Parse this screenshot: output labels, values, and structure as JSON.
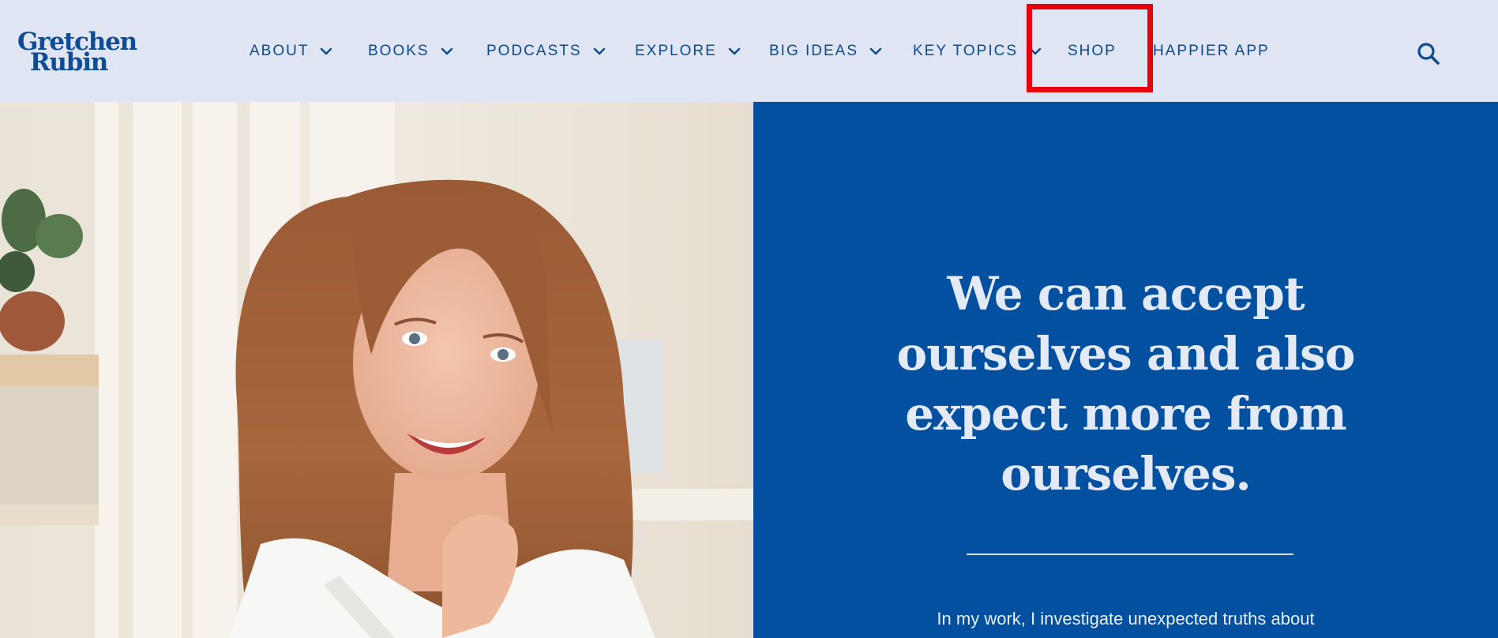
{
  "logo": {
    "line1": "Gretchen",
    "line2": "Rubin"
  },
  "nav": {
    "items": [
      {
        "label": "ABOUT",
        "has_dropdown": true
      },
      {
        "label": "BOOKS",
        "has_dropdown": true
      },
      {
        "label": "PODCASTS",
        "has_dropdown": true
      },
      {
        "label": "EXPLORE",
        "has_dropdown": true
      },
      {
        "label": "BIG IDEAS",
        "has_dropdown": true
      },
      {
        "label": "KEY TOPICS",
        "has_dropdown": true
      },
      {
        "label": "SHOP",
        "has_dropdown": false
      },
      {
        "label": "HAPPIER APP",
        "has_dropdown": false
      }
    ],
    "highlighted_item": "SHOP",
    "search_icon": "search-icon"
  },
  "hero": {
    "quote_lines": [
      "We can accept",
      "ourselves and also",
      "expect more from",
      "ourselves."
    ],
    "body": "In my work, I investigate unexpected truths about"
  },
  "colors": {
    "header_bg": "#dfe5f2",
    "nav_text": "#0b4a8f",
    "panel_bg": "#02509f",
    "quote_text": "#e4e9f6",
    "highlight_box": "#e8000b"
  }
}
